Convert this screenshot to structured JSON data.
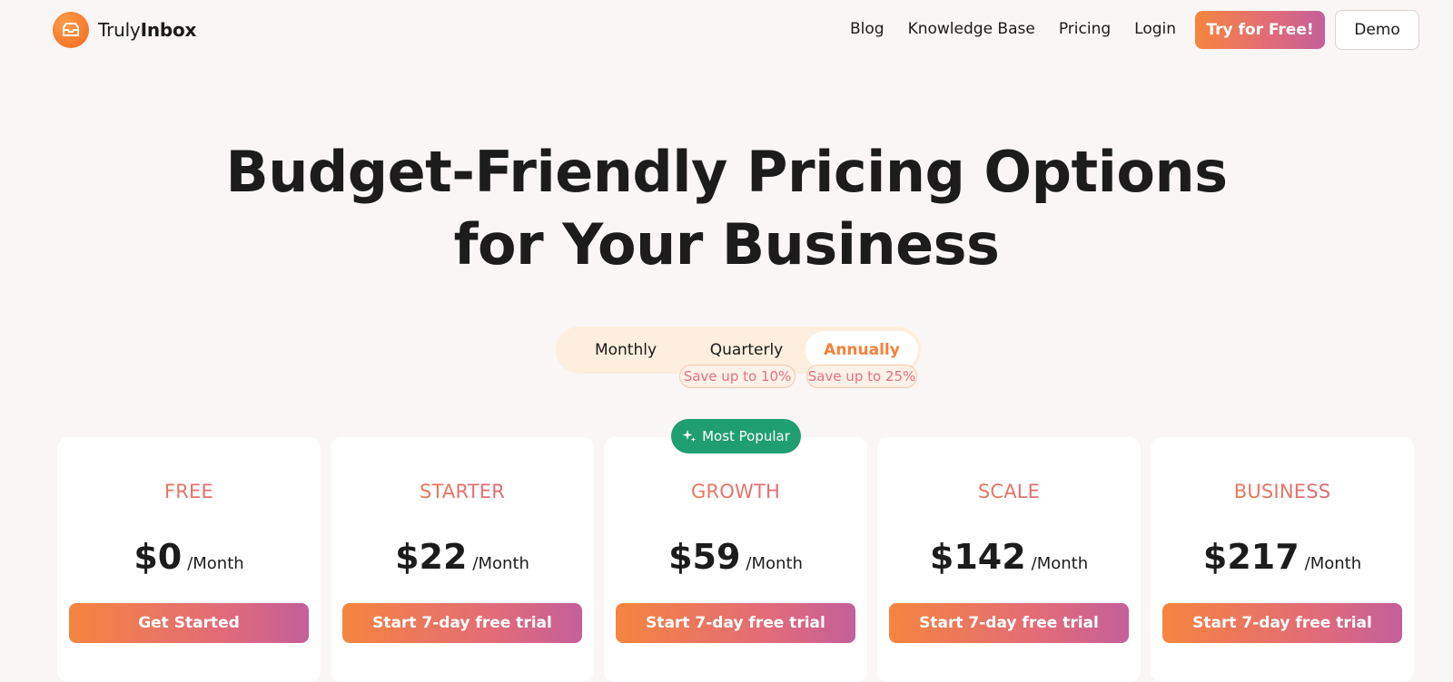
{
  "brand": {
    "name_regular": "Truly",
    "name_bold": "Inbox",
    "accent": "#f5803a"
  },
  "nav": {
    "links": [
      "Blog",
      "Knowledge Base",
      "Pricing",
      "Login"
    ],
    "try_label": "Try for Free!",
    "demo_label": "Demo"
  },
  "hero": {
    "line1": "Budget-Friendly Pricing Options",
    "line2": "for Your Business"
  },
  "billing": {
    "options": [
      "Monthly",
      "Quarterly",
      "Annually"
    ],
    "selected": "Annually",
    "quarterly_save": "Save up to 10%",
    "annual_save": "Save up to 25%"
  },
  "popular_badge": "Most Popular",
  "plans": [
    {
      "name": "FREE",
      "price": "$0",
      "period": "/Month",
      "cta": "Get Started"
    },
    {
      "name": "STARTER",
      "price": "$22",
      "period": "/Month",
      "cta": "Start 7-day free trial"
    },
    {
      "name": "GROWTH",
      "price": "$59",
      "period": "/Month",
      "cta": "Start 7-day free trial"
    },
    {
      "name": "SCALE",
      "price": "$142",
      "period": "/Month",
      "cta": "Start 7-day free trial"
    },
    {
      "name": "BUSINESS",
      "price": "$217",
      "period": "/Month",
      "cta": "Start 7-day free trial"
    }
  ],
  "colors": {
    "popular_badge": "#1f9e72",
    "gradient_start": "#f5853f",
    "gradient_end": "#c45f9a"
  }
}
